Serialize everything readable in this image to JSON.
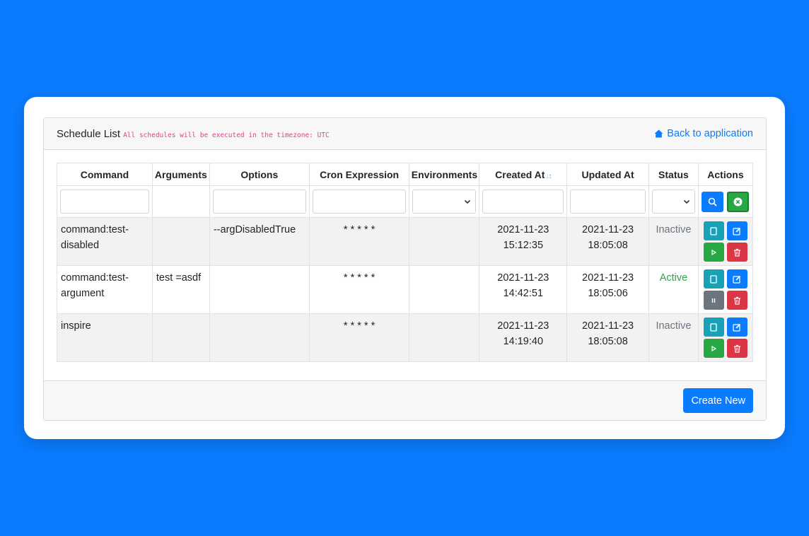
{
  "header": {
    "title": "Schedule List",
    "timezone_note": "All schedules will be executed in the timezone: UTC",
    "back_link": "Back to application"
  },
  "table": {
    "columns": [
      "Command",
      "Arguments",
      "Options",
      "Cron Expression",
      "Environments",
      "Created At",
      "Updated At",
      "Status",
      "Actions"
    ],
    "sort_indicator": "↓↕",
    "rows": [
      {
        "command": "command:test-disabled",
        "arguments": "",
        "options": "--argDisabledTrue",
        "cron": "* * * * *",
        "environments": "",
        "created_date": "2021-11-23",
        "created_time": "15:12:35",
        "updated_date": "2021-11-23",
        "updated_time": "18:05:08",
        "status": "Inactive"
      },
      {
        "command": "command:test-argument",
        "arguments": "test =asdf",
        "options": "",
        "cron": "* * * * *",
        "environments": "",
        "created_date": "2021-11-23",
        "created_time": "14:42:51",
        "updated_date": "2021-11-23",
        "updated_time": "18:05:06",
        "status": "Active"
      },
      {
        "command": "inspire",
        "arguments": "",
        "options": "",
        "cron": "* * * * *",
        "environments": "",
        "created_date": "2021-11-23",
        "created_time": "14:19:40",
        "updated_date": "2021-11-23",
        "updated_time": "18:05:08",
        "status": "Inactive"
      }
    ]
  },
  "footer": {
    "create_label": "Create New"
  },
  "colors": {
    "background": "#0a7cff",
    "link": "#0a7cff",
    "active": "#28a745",
    "inactive": "#6c757d",
    "danger": "#dc3545",
    "info": "#17a2b8"
  },
  "icons": {
    "back_link": "home-icon",
    "filter_search": "search-icon",
    "filter_clear": "clear-icon",
    "row_view": "view-icon",
    "row_edit": "edit-icon",
    "row_run": "play-icon",
    "row_pause": "pause-icon",
    "row_delete": "trash-icon"
  }
}
